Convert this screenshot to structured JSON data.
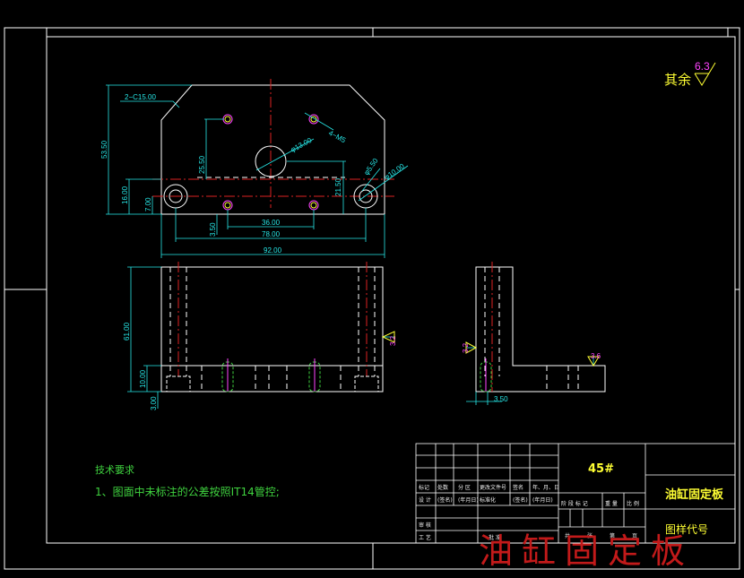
{
  "drawing": {
    "roughness_note": {
      "prefix": "其余",
      "value": "6.3"
    },
    "top_view": {
      "chamfer": "2−C15.00",
      "thread": "4−M5",
      "hole_center": "φ13.00",
      "cbore_outer": "φ10.00",
      "cbore_inner": "φ5.50",
      "dim_height_total": "53.50",
      "dim_25": "25.50",
      "dim_16": "16.00",
      "dim_7": "7.00",
      "dim_21": "21.50",
      "dim_3_5": "3.50",
      "dim_36": "36.00",
      "dim_78": "78.00",
      "dim_92": "92.00"
    },
    "front_view": {
      "dim_61": "61.00",
      "dim_10": "10.00",
      "dim_3": "3.00",
      "roughness": "3.2"
    },
    "side_view": {
      "roughness_left": "3.2",
      "roughness_right": "3.6",
      "dim_3_5": "3.50"
    },
    "tech_notes": {
      "heading": "技术要求",
      "line1": "1、图面中未标注的公差按照IT14管控;"
    }
  },
  "title_block": {
    "material": "45#",
    "part_name": "油缸固定板",
    "drawing_number_label": "图样代号",
    "cols": [
      "标记",
      "处数",
      "分 区",
      "更改文件号",
      "签名",
      "年、月、日"
    ],
    "row_sign": [
      "设 计",
      "(签名)",
      "(年月日)",
      "标准化",
      "(签名)",
      "(年月日)"
    ],
    "stage_cols": [
      "阶 段 标 记",
      "重 量",
      "比 例"
    ],
    "review": "审 核",
    "process": "工 艺",
    "approve": "批 准",
    "sheet": [
      "共",
      "张",
      "第",
      "页"
    ]
  },
  "watermark": "油缸固定板"
}
